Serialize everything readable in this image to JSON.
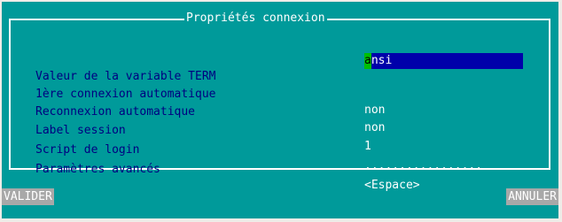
{
  "dialog": {
    "title": "Propriétés connexion"
  },
  "settings": [
    {
      "label": "Valeur de la variable TERM",
      "value": "ansi"
    },
    {
      "label": "1ère connexion automatique",
      "value": "non"
    },
    {
      "label": "Reconnexion automatique",
      "value": "non"
    },
    {
      "label": "Label session",
      "value": "1"
    },
    {
      "label": "Script de login",
      "value": "................."
    },
    {
      "label": "Paramètres avancés",
      "value": "<Espace>"
    }
  ],
  "term_input": {
    "first_char": "a",
    "rest": "nsi"
  },
  "buttons": {
    "validate": "VALIDER",
    "cancel": "ANNULER"
  },
  "colors": {
    "background": "#009a9a",
    "label_text": "#000080",
    "value_text": "#ffffff",
    "input_field": "#0000aa",
    "cursor": "#00c000",
    "button": "#a8a8a8"
  }
}
